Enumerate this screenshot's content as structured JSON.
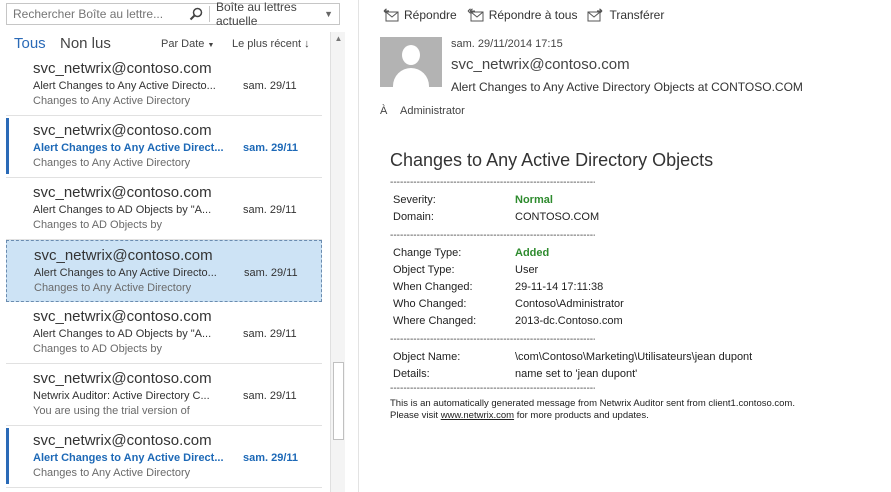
{
  "search": {
    "placeholder": "Rechercher Boîte au lettre...",
    "scope": "Boîte au lettres actuelle"
  },
  "filters": {
    "all": "Tous",
    "unread": "Non lus",
    "sort_by": "Par Date",
    "sort_order": "Le plus récent"
  },
  "messages": [
    {
      "from": "svc_netwrix@contoso.com",
      "subject": "Alert Changes to Any Active Directo...",
      "date": "sam. 29/11",
      "preview": "Changes to Any Active Directory",
      "unread": false,
      "selected": false
    },
    {
      "from": "svc_netwrix@contoso.com",
      "subject": "Alert Changes to Any Active Direct...",
      "date": "sam. 29/11",
      "preview": "Changes to Any Active Directory",
      "unread": true,
      "selected": false
    },
    {
      "from": "svc_netwrix@contoso.com",
      "subject": "Alert Changes to AD Objects by \"A...",
      "date": "sam. 29/11",
      "preview": "Changes to AD Objects by",
      "unread": false,
      "selected": false
    },
    {
      "from": "svc_netwrix@contoso.com",
      "subject": "Alert Changes to Any Active Directo...",
      "date": "sam. 29/11",
      "preview": "Changes to Any Active Directory",
      "unread": false,
      "selected": true
    },
    {
      "from": "svc_netwrix@contoso.com",
      "subject": "Alert Changes to AD Objects by \"A...",
      "date": "sam. 29/11",
      "preview": "Changes to AD Objects by",
      "unread": false,
      "selected": false
    },
    {
      "from": "svc_netwrix@contoso.com",
      "subject": "Netwrix Auditor: Active Directory C...",
      "date": "sam. 29/11",
      "preview": "You are using the trial version of",
      "unread": false,
      "selected": false
    },
    {
      "from": "svc_netwrix@contoso.com",
      "subject": "Alert Changes to Any Active Direct...",
      "date": "sam. 29/11",
      "preview": "Changes to Any Active Directory",
      "unread": true,
      "selected": false
    }
  ],
  "toolbar": {
    "reply": "Répondre",
    "reply_all": "Répondre à tous",
    "forward": "Transférer"
  },
  "header": {
    "date": "sam. 29/11/2014 17:15",
    "from": "svc_netwrix@contoso.com",
    "subject": "Alert Changes to Any Active Directory Objects at CONTOSO.COM",
    "to_label": "À",
    "to": "Administrator"
  },
  "body": {
    "title": "Changes to Any Active Directory Objects",
    "rule": "------------------------------------------------------------------------",
    "severity_label": "Severity:",
    "severity": "Normal",
    "domain_label": "Domain:",
    "domain": "CONTOSO.COM",
    "change_type_label": "Change Type:",
    "change_type": "Added",
    "object_type_label": "Object Type:",
    "object_type": "User",
    "when_label": "When Changed:",
    "when": "29-11-14 17:11:38",
    "who_label": "Who Changed:",
    "who": "Contoso\\Administrator",
    "where_label": "Where Changed:",
    "where": "2013-dc.Contoso.com",
    "object_name_label": "Object Name:",
    "object_name": "\\com\\Contoso\\Marketing\\Utilisateurs\\jean dupont",
    "details_label": "Details:",
    "details": "name set to 'jean dupont'",
    "footer_line1": "This is an automatically generated message from Netwrix Auditor sent from client1.contoso.com.",
    "footer_pre": "Please visit ",
    "footer_link": "www.netwrix.com",
    "footer_post": " for more products and updates."
  },
  "colors": {
    "accent": "#2a6ab7",
    "selected_bg": "#cde3f5",
    "status_green": "#2e8b2e"
  }
}
